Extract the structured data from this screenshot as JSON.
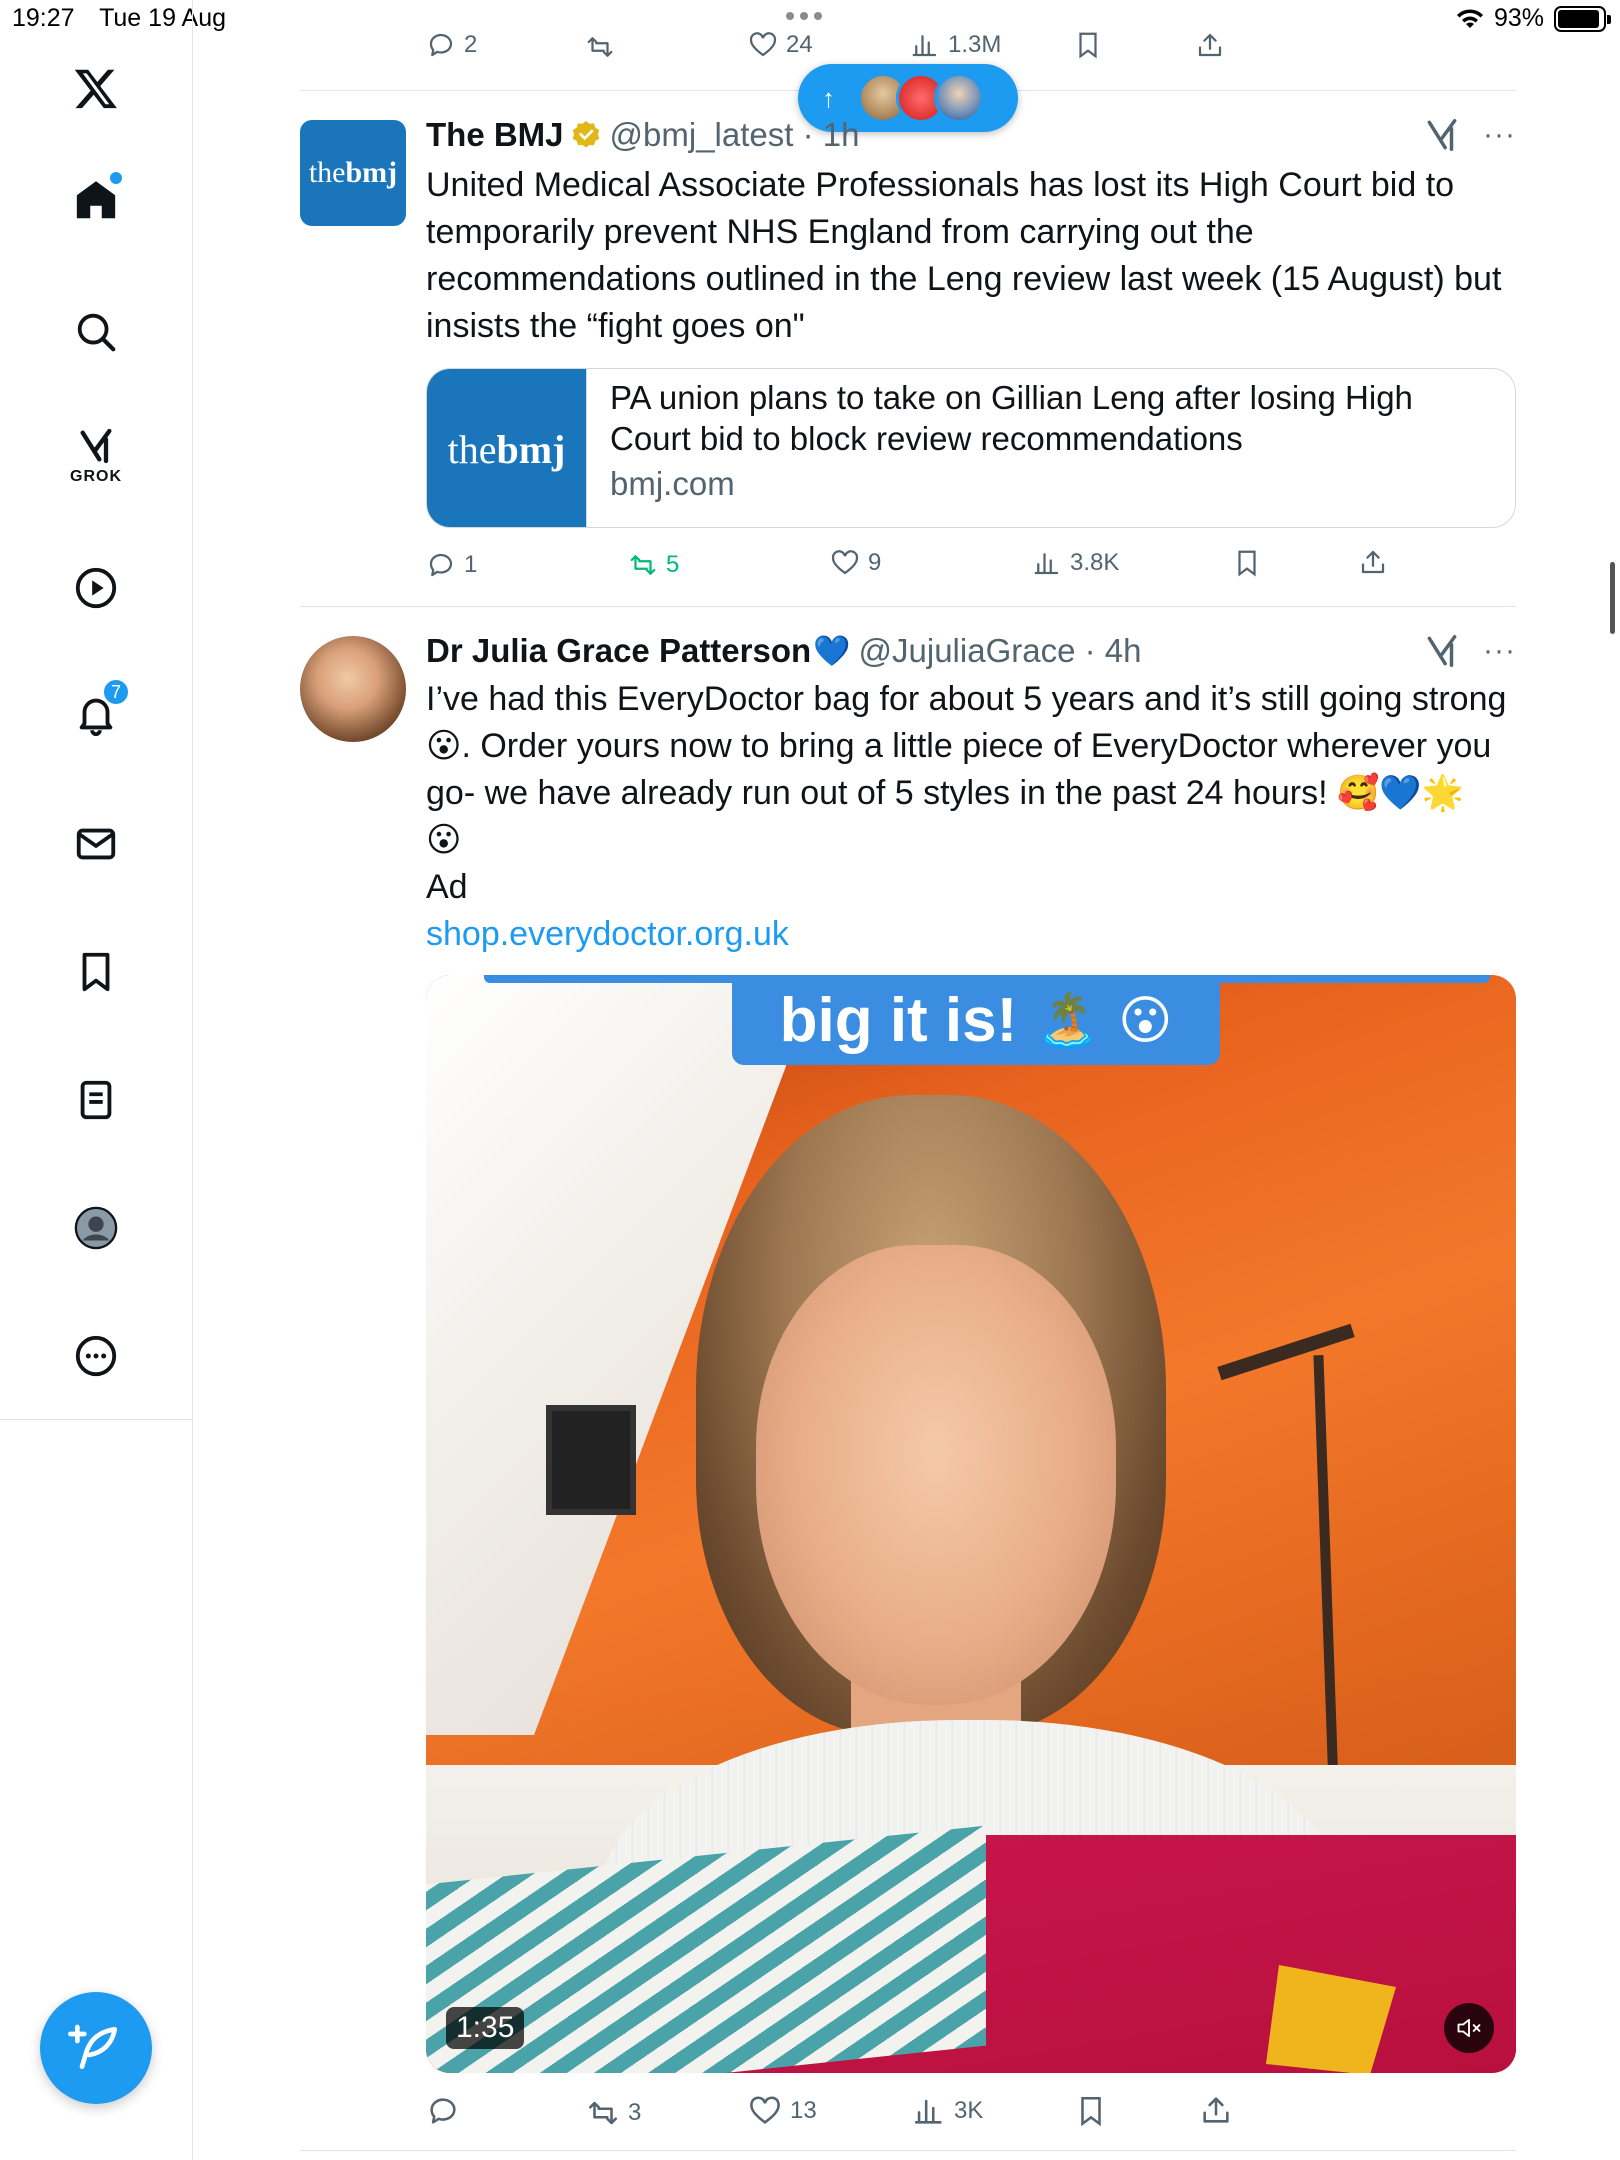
{
  "status_bar": {
    "time": "19:27",
    "date": "Tue 19 Aug",
    "battery": "93%",
    "battery_level": 0.93
  },
  "sidebar": {
    "items": [
      {
        "name": "x-logo"
      },
      {
        "name": "home",
        "has_dot": true
      },
      {
        "name": "search"
      },
      {
        "name": "grok",
        "label": "GROK"
      },
      {
        "name": "video"
      },
      {
        "name": "notifications",
        "badge": "7"
      },
      {
        "name": "messages"
      },
      {
        "name": "bookmarks"
      },
      {
        "name": "lists"
      },
      {
        "name": "profile"
      },
      {
        "name": "more"
      }
    ],
    "compose_icon": "feather-plus-icon"
  },
  "colors": {
    "accent": "#1d9bf0",
    "retweet_active": "#00ba7c",
    "muted": "#536471",
    "bmj_blue": "#1a75bb"
  },
  "previous_tweet_actions": {
    "replies": "2",
    "likes": "24",
    "views": "1.3M"
  },
  "new_posts_pill": {
    "icon": "arrow-up-icon"
  },
  "tweets": [
    {
      "display_name": "The BMJ",
      "handle": "@bmj_latest · 1h",
      "verified": "gold",
      "avatar_text_a": "the",
      "avatar_text_b": "bmj",
      "text": "United Medical Associate Professionals has lost its High Court bid to temporarily prevent NHS England from carrying out the recommendations outlined in the Leng review last week (15 August) but insists the “fight goes on\"",
      "card": {
        "logo_a": "the",
        "logo_b": "bmj",
        "title": "PA union plans to take on Gillian Leng after losing High Court bid to block review recommendations",
        "domain": "bmj.com"
      },
      "actions": {
        "replies": "1",
        "retweets": "5",
        "likes": "9",
        "views": "3.8K"
      }
    },
    {
      "display_name": "Dr Julia Grace Patterson",
      "name_emoji": "💙",
      "handle": "@JujuliaGrace · 4h",
      "text_line1": "I’ve had this EveryDoctor bag for about 5 years and it’s still going strong",
      "text_line2": "😮. Order yours now to bring a little piece of EveryDoctor wherever you",
      "text_line3": "go- we have already run out of 5 styles in the past 24 hours! 🥰💙🌟",
      "text_line4": "😮",
      "text_ad": "Ad",
      "link": "shop.everydoctor.org.uk",
      "video": {
        "caption": "big it is!",
        "caption_emoji": "🏝️ 😮",
        "duration": "1:35",
        "muted": true
      },
      "actions": {
        "replies": "",
        "retweets": "3",
        "likes": "13",
        "views": "3K"
      }
    }
  ]
}
